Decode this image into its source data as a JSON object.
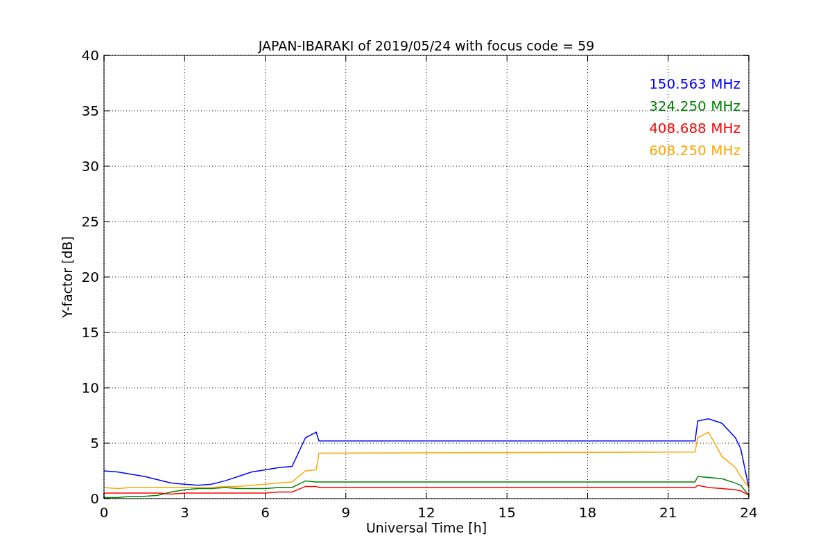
{
  "chart_data": {
    "type": "line",
    "title": "JAPAN-IBARAKI of 2019/05/24 with focus code = 59",
    "xlabel": "Universal Time [h]",
    "ylabel": "Y-factor [dB]",
    "x": [
      0,
      0.5,
      1,
      1.5,
      2,
      2.5,
      3,
      3.5,
      4,
      4.5,
      5,
      5.5,
      6,
      6.5,
      7,
      7.5,
      7.9,
      8,
      22,
      22.1,
      22.5,
      23,
      23.5,
      23.7,
      24
    ],
    "series": [
      {
        "name": "150.563 MHz",
        "color": "#0000ff",
        "values": [
          2.5,
          2.4,
          2.2,
          2.0,
          1.7,
          1.4,
          1.3,
          1.2,
          1.3,
          1.6,
          2.0,
          2.4,
          2.6,
          2.8,
          2.9,
          5.5,
          6.0,
          5.2,
          5.2,
          7.0,
          7.2,
          6.8,
          5.5,
          4.5,
          1.0
        ]
      },
      {
        "name": "324.250 MHz",
        "color": "#008000",
        "values": [
          0.1,
          0.1,
          0.2,
          0.2,
          0.3,
          0.6,
          0.8,
          0.9,
          0.9,
          1.0,
          0.9,
          0.9,
          0.9,
          1.0,
          1.0,
          1.6,
          1.5,
          1.5,
          1.5,
          2.0,
          1.9,
          1.8,
          1.4,
          1.2,
          0.3
        ]
      },
      {
        "name": "408.688 MHz",
        "color": "#ff0000",
        "values": [
          0.5,
          0.5,
          0.5,
          0.5,
          0.5,
          0.4,
          0.5,
          0.5,
          0.5,
          0.5,
          0.5,
          0.5,
          0.5,
          0.6,
          0.6,
          1.1,
          1.1,
          1.0,
          1.0,
          1.2,
          1.0,
          0.9,
          0.8,
          0.7,
          0.3
        ]
      },
      {
        "name": "608.250 MHz",
        "color": "#ffa500",
        "values": [
          1.0,
          0.9,
          1.0,
          1.0,
          1.0,
          1.0,
          1.0,
          1.0,
          1.0,
          1.1,
          1.1,
          1.2,
          1.3,
          1.4,
          1.5,
          2.5,
          2.6,
          4.1,
          4.2,
          5.5,
          6.0,
          3.8,
          2.8,
          2.0,
          1.0
        ]
      }
    ],
    "grid": true,
    "xlim": [
      0,
      24
    ],
    "ylim": [
      0,
      40
    ],
    "xticks": [
      0,
      3,
      6,
      9,
      12,
      15,
      18,
      21,
      24
    ],
    "yticks": [
      0,
      5,
      10,
      15,
      20,
      25,
      30,
      35,
      40
    ]
  }
}
